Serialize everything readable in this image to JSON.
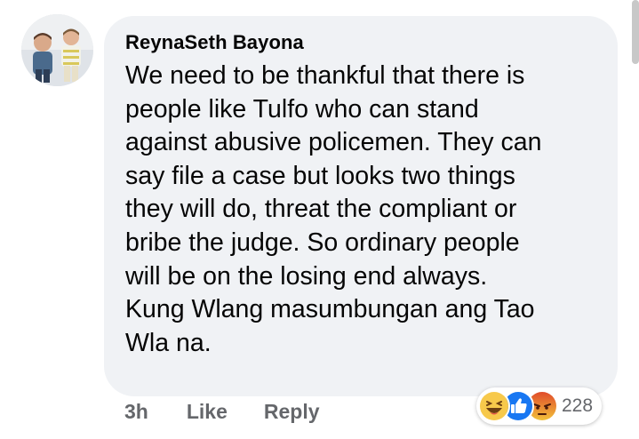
{
  "comment": {
    "author": "ReynaSeth Bayona",
    "text": "We need to be thankful that there is\npeople like Tulfo who can stand\nagainst abusive policemen. They can\nsay file a case but looks two things\nthey will do, threat the compliant or\nbribe the judge. So ordinary people\nwill be on the losing end always.\nKung Wlang masumbungan ang Tao\nWla na."
  },
  "actions": {
    "time": "3h",
    "like_label": "Like",
    "reply_label": "Reply"
  },
  "reactions": {
    "icons": [
      "haha-reaction-icon",
      "like-reaction-icon",
      "angry-reaction-icon"
    ],
    "count": "228"
  },
  "colors": {
    "bubble_bg": "#f0f2f5",
    "meta_text": "#65676b",
    "like_blue": "#1877f2",
    "haha_yellow": "#f7c94b",
    "angry_orange": "#e9710f"
  }
}
